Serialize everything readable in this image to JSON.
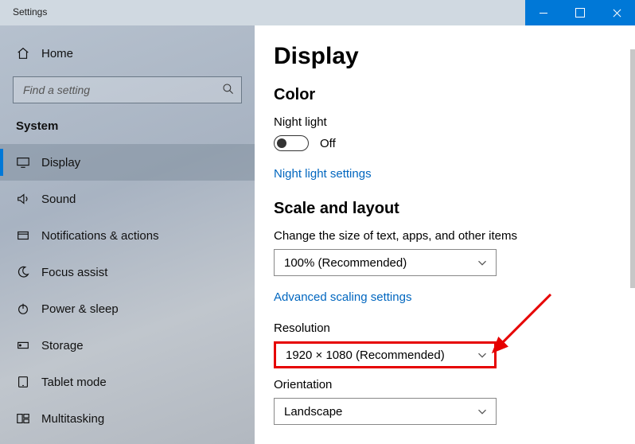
{
  "window": {
    "title": "Settings"
  },
  "sidebar": {
    "home": "Home",
    "search_placeholder": "Find a setting",
    "category": "System",
    "items": [
      {
        "label": "Display",
        "icon": "display",
        "selected": true
      },
      {
        "label": "Sound",
        "icon": "sound",
        "selected": false
      },
      {
        "label": "Notifications & actions",
        "icon": "notify",
        "selected": false
      },
      {
        "label": "Focus assist",
        "icon": "moon",
        "selected": false
      },
      {
        "label": "Power & sleep",
        "icon": "power",
        "selected": false
      },
      {
        "label": "Storage",
        "icon": "storage",
        "selected": false
      },
      {
        "label": "Tablet mode",
        "icon": "tablet",
        "selected": false
      },
      {
        "label": "Multitasking",
        "icon": "multitask",
        "selected": false
      }
    ]
  },
  "content": {
    "title": "Display",
    "section_color": "Color",
    "night_light_label": "Night light",
    "night_light_state": "Off",
    "night_light_link": "Night light settings",
    "section_scale": "Scale and layout",
    "scale_label": "Change the size of text, apps, and other items",
    "scale_value": "100% (Recommended)",
    "adv_scale_link": "Advanced scaling settings",
    "resolution_label": "Resolution",
    "resolution_value": "1920 × 1080 (Recommended)",
    "orientation_label": "Orientation",
    "orientation_value": "Landscape"
  }
}
